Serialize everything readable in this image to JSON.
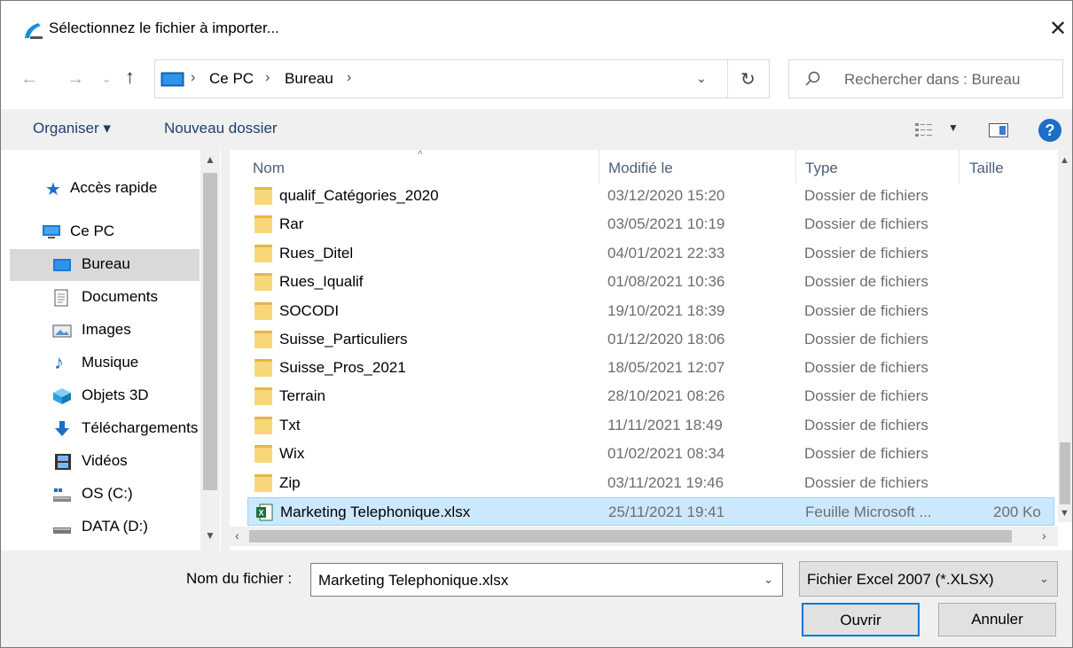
{
  "window": {
    "title": "Sélectionnez le fichier à importer..."
  },
  "address": {
    "crumbs": [
      "Ce PC",
      "Bureau"
    ]
  },
  "search": {
    "placeholder": "Rechercher dans : Bureau"
  },
  "toolbar": {
    "organize": "Organiser ▾",
    "new_folder": "Nouveau dossier"
  },
  "nav": [
    {
      "label": "Accès rapide",
      "icon": "star-icon"
    },
    {
      "label": "Ce PC",
      "icon": "computer-icon"
    },
    {
      "label": "Bureau",
      "icon": "desktop-icon"
    },
    {
      "label": "Documents",
      "icon": "documents-icon"
    },
    {
      "label": "Images",
      "icon": "images-icon"
    },
    {
      "label": "Musique",
      "icon": "music-icon"
    },
    {
      "label": "Objets 3D",
      "icon": "objects3d-icon"
    },
    {
      "label": "Téléchargements",
      "icon": "downloads-icon"
    },
    {
      "label": "Vidéos",
      "icon": "videos-icon"
    },
    {
      "label": "OS (C:)",
      "icon": "drive-c-icon"
    },
    {
      "label": "DATA (D:)",
      "icon": "drive-d-icon"
    }
  ],
  "columns": {
    "name": "Nom",
    "modified": "Modifié le",
    "type": "Type",
    "size": "Taille"
  },
  "files": [
    {
      "name": "qualif_Catégories_2020",
      "date": "03/12/2020 15:20",
      "type": "Dossier de fichiers",
      "size": ""
    },
    {
      "name": "Rar",
      "date": "03/05/2021 10:19",
      "type": "Dossier de fichiers",
      "size": ""
    },
    {
      "name": "Rues_Ditel",
      "date": "04/01/2021 22:33",
      "type": "Dossier de fichiers",
      "size": ""
    },
    {
      "name": "Rues_Iqualif",
      "date": "01/08/2021 10:36",
      "type": "Dossier de fichiers",
      "size": ""
    },
    {
      "name": "SOCODI",
      "date": "19/10/2021 18:39",
      "type": "Dossier de fichiers",
      "size": ""
    },
    {
      "name": "Suisse_Particuliers",
      "date": "01/12/2020 18:06",
      "type": "Dossier de fichiers",
      "size": ""
    },
    {
      "name": "Suisse_Pros_2021",
      "date": "18/05/2021 12:07",
      "type": "Dossier de fichiers",
      "size": ""
    },
    {
      "name": "Terrain",
      "date": "28/10/2021 08:26",
      "type": "Dossier de fichiers",
      "size": ""
    },
    {
      "name": "Txt",
      "date": "11/11/2021 18:49",
      "type": "Dossier de fichiers",
      "size": ""
    },
    {
      "name": "Wix",
      "date": "01/02/2021 08:34",
      "type": "Dossier de fichiers",
      "size": ""
    },
    {
      "name": "Zip",
      "date": "03/11/2021 19:46",
      "type": "Dossier de fichiers",
      "size": ""
    },
    {
      "name": "Marketing Telephonique.xlsx",
      "date": "25/11/2021 19:41",
      "type": "Feuille Microsoft ...",
      "size": "200 Ko"
    }
  ],
  "bottom": {
    "filename_label": "Nom du fichier :",
    "filename_value": "Marketing Telephonique.xlsx",
    "filetype": "Fichier Excel 2007 (*.XLSX)",
    "open": "Ouvrir",
    "cancel": "Annuler"
  },
  "colors": {
    "accent": "#0078d7",
    "selection": "#cce8ff",
    "folder": "#f7d77a",
    "excel": "#1d6f42"
  }
}
